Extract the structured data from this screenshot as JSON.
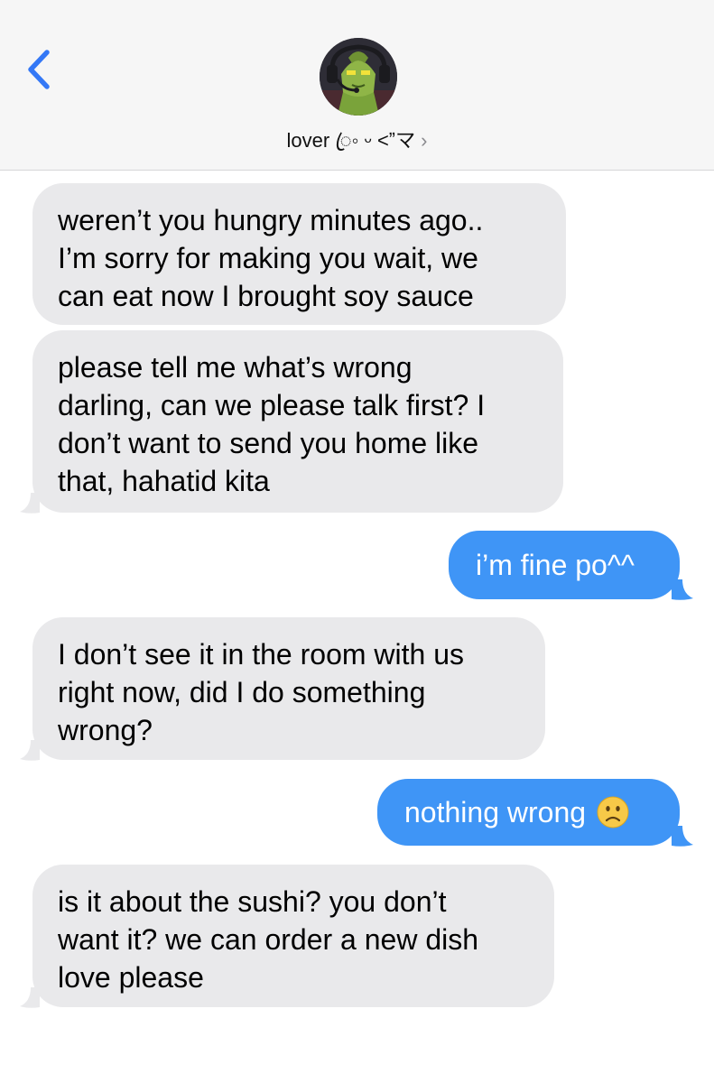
{
  "header": {
    "back_icon": "chevron-left-icon",
    "avatar_icon": "green-robot-avatar",
    "contact_name": "lover ꦿ◦ ᵕ ˂ˮマ",
    "contact_chevron": "›"
  },
  "messages": [
    {
      "direction": "incoming",
      "text": "weren’t you hungry minutes ago..\nI’m sorry for making you wait, we\ncan eat now I brought soy sauce"
    },
    {
      "direction": "incoming",
      "text": "please tell me what’s wrong\ndarling, can we please talk first? I\ndon’t want to send you home like\nthat, hahatid kita"
    },
    {
      "direction": "outgoing",
      "text": "i’m fine po^^"
    },
    {
      "direction": "incoming",
      "text": "I don’t see it in the room with us\nright now, did I do something\nwrong?"
    },
    {
      "direction": "outgoing",
      "text": "nothing wrong",
      "emoji": "slightly-frowning-face-icon"
    },
    {
      "direction": "incoming",
      "text": "is it about the sushi? you don’t\nwant it? we can order a new dish\nlove please"
    }
  ],
  "colors": {
    "incoming_bubble": "#e9e9eb",
    "outgoing_bubble": "#3f95f6",
    "accent": "#3478f6",
    "header_bg": "#f6f6f6"
  }
}
